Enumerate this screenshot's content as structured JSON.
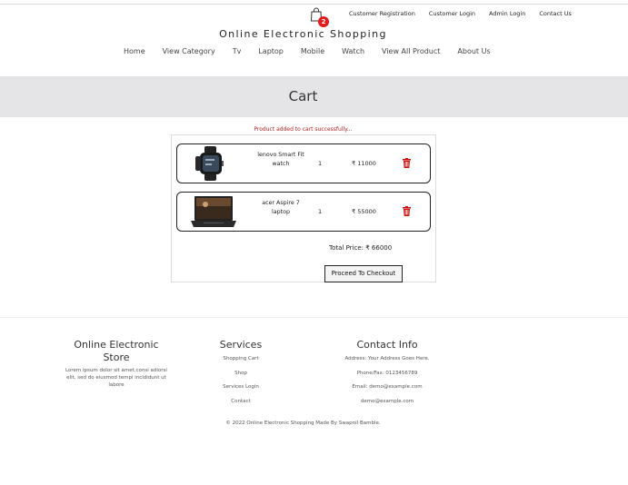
{
  "header": {
    "cart_count": "2",
    "top_links": [
      "Customer Registration",
      "Customer Login",
      "Admin Login",
      "Contact Us"
    ],
    "brand": "Online Electronic Shopping",
    "nav": [
      "Home",
      "View Category",
      "Tv",
      "Laptop",
      "Mobile",
      "Watch",
      "View All Product",
      "About Us"
    ]
  },
  "page_title": "Cart",
  "cart": {
    "message": "Product added to cart successfully...",
    "items": [
      {
        "name": "lenovo Smart Fit watch",
        "qty": "1",
        "price": "₹ 11000"
      },
      {
        "name": "acer Aspire 7 laptop",
        "qty": "1",
        "price": "₹ 55000"
      }
    ],
    "total": "Total Price: ₹ 66000",
    "checkout_label": "Proceed To Checkout"
  },
  "footer": {
    "store_title": "Online Electronic Store",
    "store_text": "Lorem ipsum dolor sit amet,consi adiorsi elit, sed do eiusmod tempi incididunt ut labore",
    "services_title": "Services",
    "services_links": [
      "Shopping Cart",
      "Shop",
      "Services Login",
      "Contact"
    ],
    "contact_title": "Contact Info",
    "contact_items": [
      "Address: Your Address Goes Here.",
      "Phone/Fax: 0123456789",
      "Email: demo@example.com",
      "demo@example.com"
    ],
    "copyright": "© 2022 Online Electronic Shopping Made By Swapnil Bamble."
  },
  "colors": {
    "badge": "#e01b1b",
    "trash": "#cc1111",
    "message": "#b02020",
    "banner": "#e5e5e8"
  }
}
